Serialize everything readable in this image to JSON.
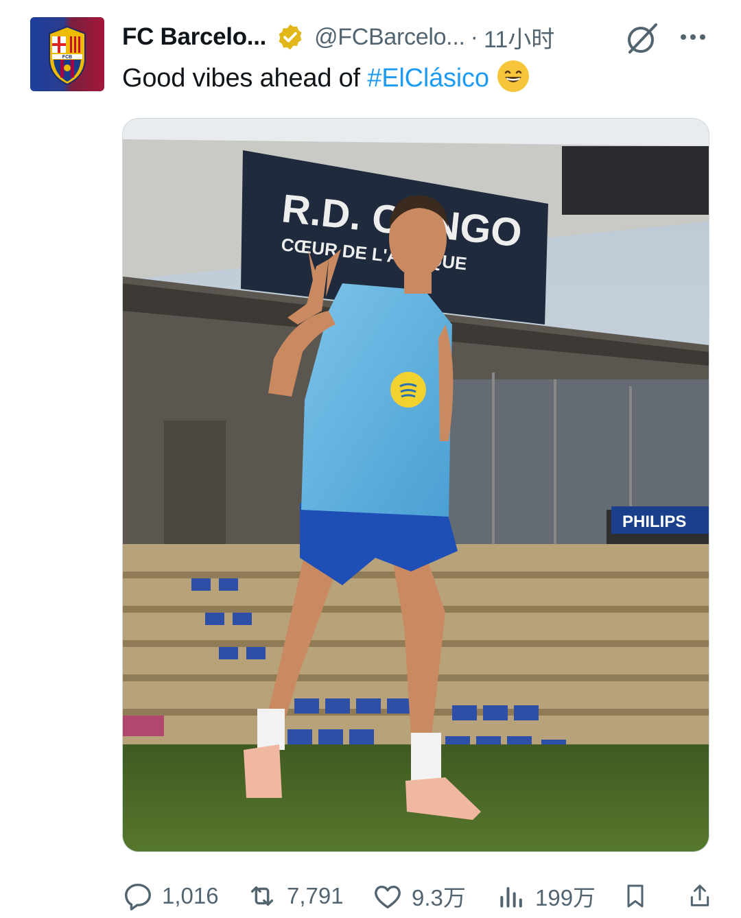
{
  "tweet": {
    "author_name": "FC Barcelo...",
    "handle": "@FCBarcelo...",
    "separator": "·",
    "timestamp": "11小时",
    "text": "Good vibes ahead of ",
    "hashtag": "#ElClásico",
    "avatar_crest_label": "FCB"
  },
  "media": {
    "sign_main": "R.D. CONGO",
    "sign_sub": "CŒUR DE L'AFRIQUE",
    "side_sign": "PHILIPS"
  },
  "actions": {
    "replies": "1,016",
    "reposts": "7,791",
    "likes": "9.3万",
    "views": "199万"
  },
  "colors": {
    "accent": "#1d9bf0",
    "muted": "#536471",
    "verified_gold": "#e2b719"
  },
  "icons": [
    "verified-badge-icon",
    "grok-icon",
    "more-icon",
    "reply-icon",
    "repost-icon",
    "like-icon",
    "views-icon",
    "bookmark-icon",
    "share-icon"
  ]
}
